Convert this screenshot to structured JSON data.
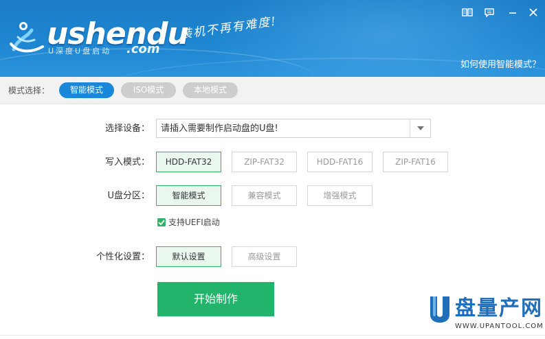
{
  "header": {
    "logo_text": "ushendu",
    "logo_sub": "U深度U盘启动",
    "logo_dotcom": ".com",
    "slogan": "装机不再有难度!",
    "help_link": "如何使用智能模式？",
    "controls": [
      {
        "name": "manual-icon"
      },
      {
        "name": "feedback-icon"
      },
      {
        "name": "minimize-icon"
      },
      {
        "name": "close-icon"
      }
    ]
  },
  "modebar": {
    "label": "模式选择：",
    "tabs": [
      {
        "label": "智能模式",
        "active": true
      },
      {
        "label": "ISO模式",
        "active": false
      },
      {
        "label": "本地模式",
        "active": false
      }
    ]
  },
  "form": {
    "device": {
      "label": "选择设备：",
      "value": "请插入需要制作启动盘的U盘!"
    },
    "write_mode": {
      "label": "写入模式：",
      "options": [
        "HDD-FAT32",
        "ZIP-FAT32",
        "HDD-FAT16",
        "ZIP-FAT16"
      ],
      "selected": 0
    },
    "partition": {
      "label": "U盘分区：",
      "options": [
        "智能模式",
        "兼容模式",
        "增强模式"
      ],
      "selected": 0
    },
    "uefi": {
      "label": "支持UEFI启动",
      "checked": true
    },
    "personalize": {
      "label": "个性化设置：",
      "options": [
        "默认设置",
        "高级设置"
      ],
      "selected": 0
    },
    "start_button": "开始制作"
  },
  "watermark": {
    "text": "盘量产网",
    "url": "WWW.UPANTOOL.COM"
  },
  "colors": {
    "header_blue": "#1e86d1",
    "active_tab": "#1a87d8",
    "green": "#22b46b",
    "watermark_blue": "#1f6fbd"
  }
}
